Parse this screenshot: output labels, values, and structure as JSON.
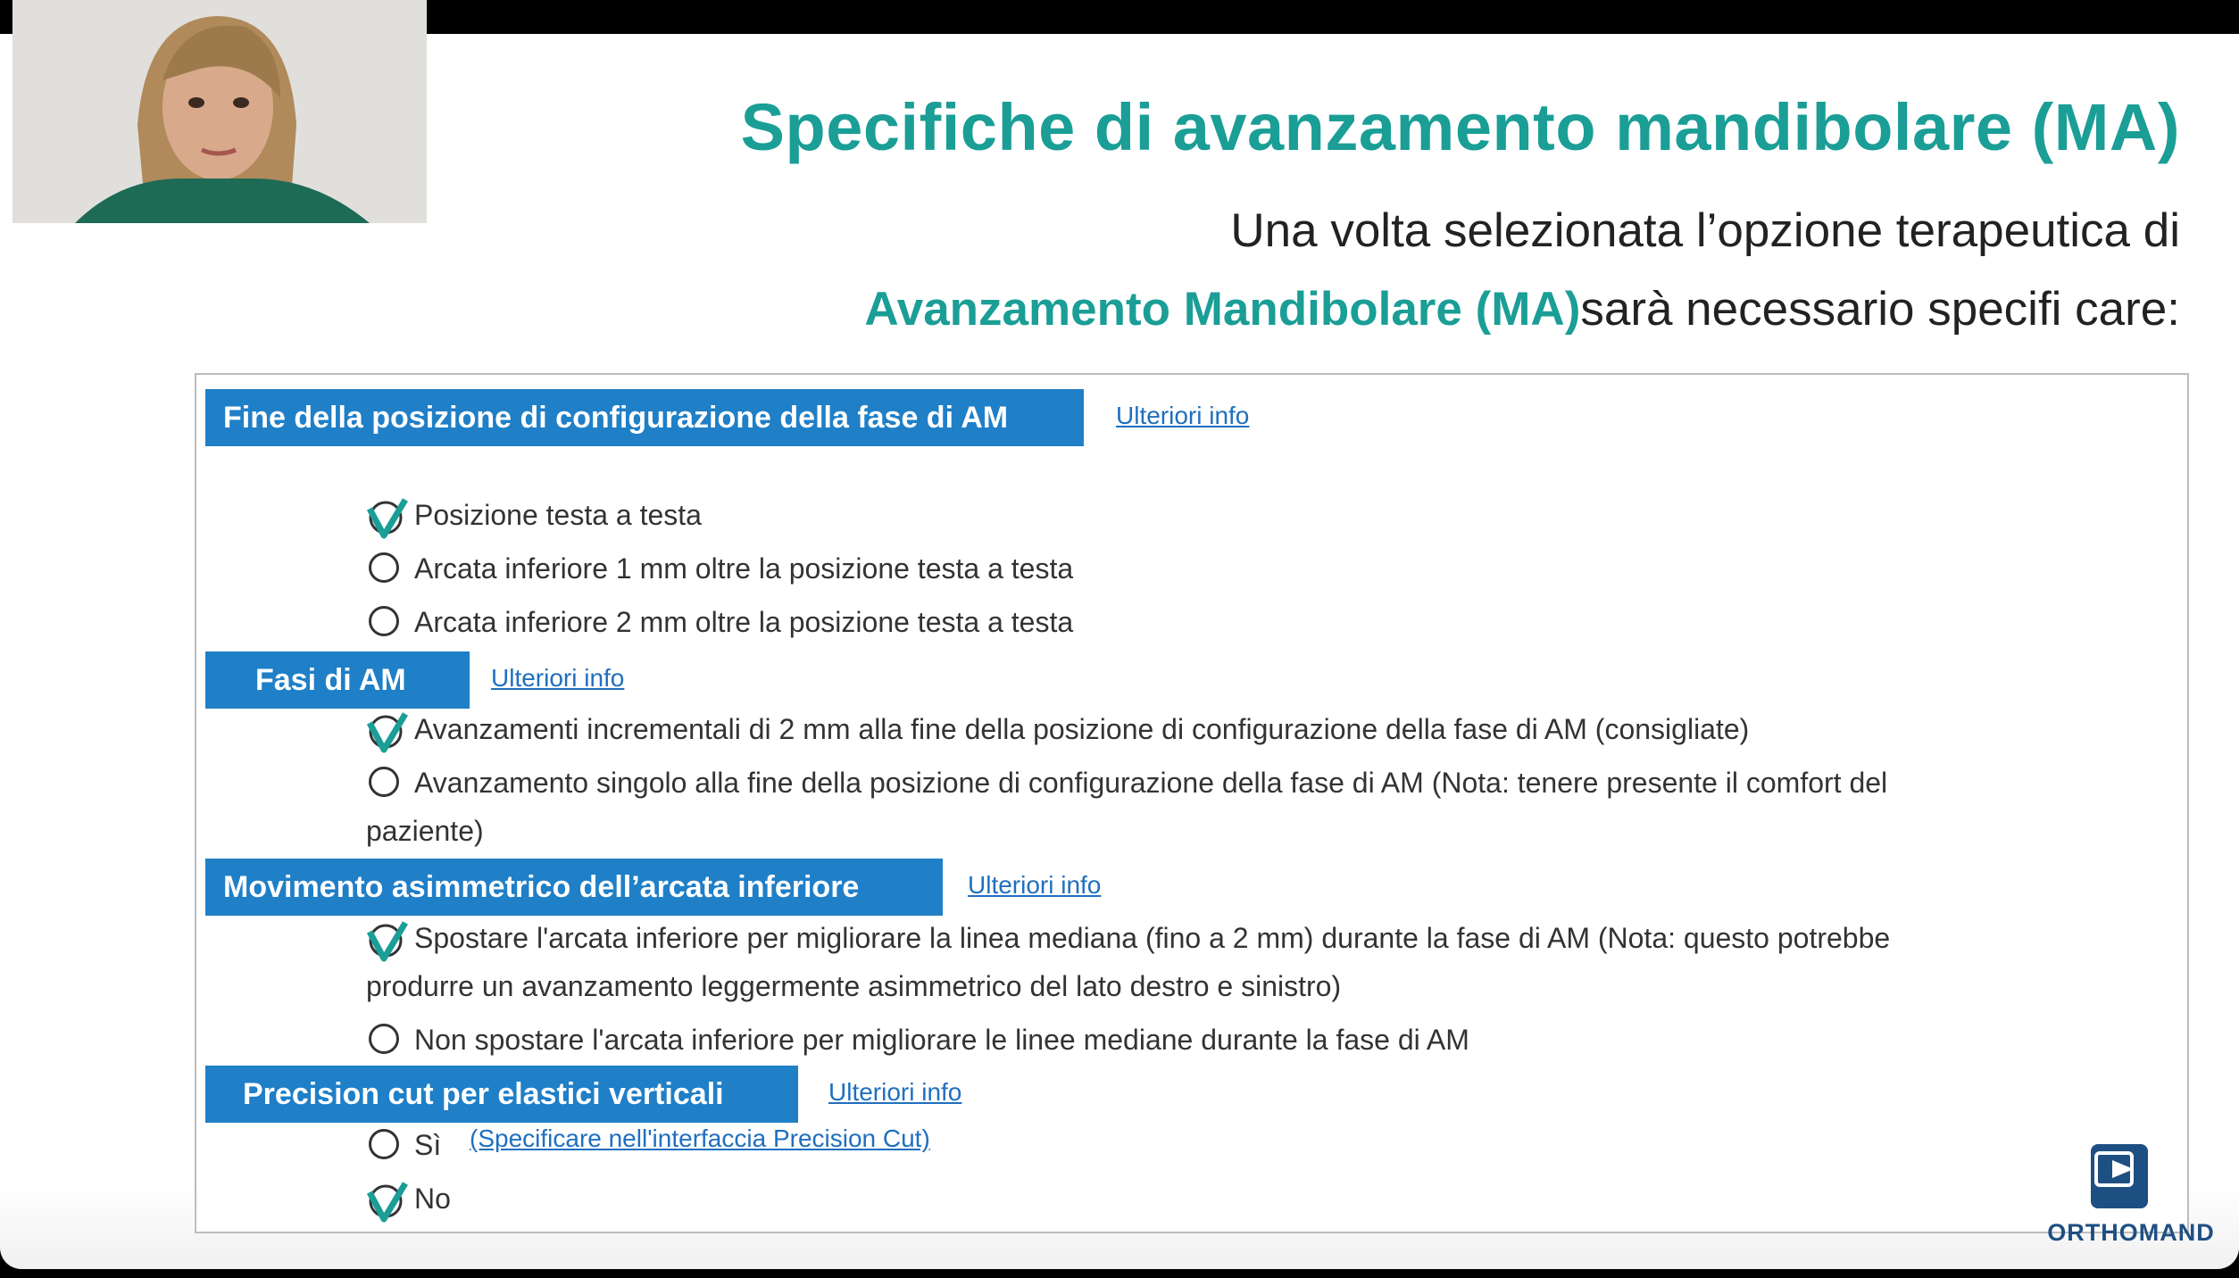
{
  "slide": {
    "title": "Specifiche di avanzamento mandibolare (MA)",
    "subtitle_line1": "Una volta selezionata l’opzione terapeutica di",
    "subtitle_highlight": "Avanzamento Mandibolare (MA)",
    "subtitle_rest": "sarà necessario specifi care:"
  },
  "form": {
    "sections": [
      {
        "title": "Fine della posizione di configurazione della fase di AM",
        "link": "Ulteriori info",
        "options": [
          {
            "label": "Posizione testa a testa",
            "selected": true
          },
          {
            "label": "Arcata inferiore 1 mm oltre la posizione testa a testa",
            "selected": false
          },
          {
            "label": "Arcata inferiore 2 mm oltre la posizione testa a testa",
            "selected": false
          }
        ]
      },
      {
        "title": "Fasi di AM",
        "link": "Ulteriori info",
        "options": [
          {
            "label": "Avanzamenti incrementali di 2 mm alla fine della posizione di configurazione della fase di AM (consigliate)",
            "selected": true
          },
          {
            "label": "Avanzamento singolo alla fine della posizione di configurazione della fase di AM (Nota: tenere presente il comfort del",
            "label_cont": "paziente)",
            "selected": false
          }
        ]
      },
      {
        "title": "Movimento asimmetrico dell’arcata inferiore",
        "link": "Ulteriori info",
        "options": [
          {
            "label": "Spostare l'arcata inferiore per migliorare la linea mediana (fino a 2 mm) durante la fase di AM (Nota: questo potrebbe",
            "label_cont": "produrre un avanzamento leggermente asimmetrico del lato destro e sinistro)",
            "selected": true
          },
          {
            "label": "Non spostare l'arcata inferiore per migliorare le linee mediane durante la fase di AM",
            "selected": false
          }
        ]
      },
      {
        "title": "Precision cut per elastici verticali",
        "link": "Ulteriori info",
        "options": [
          {
            "label": "Sì",
            "extra_link": "(Specificare nell'interfaccia Precision Cut)",
            "selected": false
          },
          {
            "label": "No",
            "selected": true
          }
        ]
      }
    ]
  },
  "logo": {
    "text": "ORTHOMAND",
    "icon": "play-icon"
  },
  "colors": {
    "accent": "#1a9e96",
    "section_bar": "#1f7fc7",
    "link": "#1f6fbf",
    "logo": "#1e4f82"
  }
}
